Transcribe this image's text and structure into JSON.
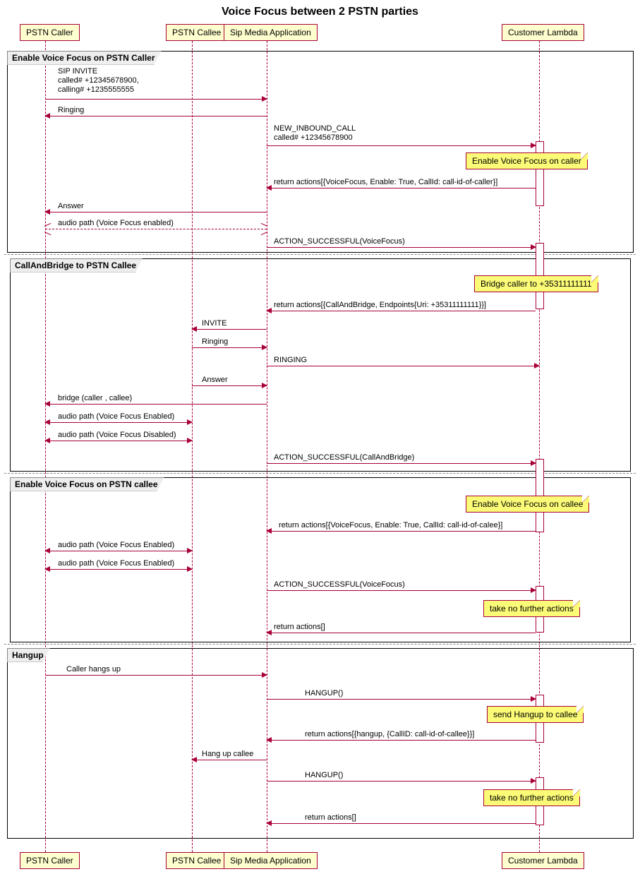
{
  "title": "Voice Focus between 2 PSTN parties",
  "participants": {
    "caller": "PSTN Caller",
    "callee": "PSTN Callee",
    "sma": "Sip Media Application",
    "lambda": "Customer Lambda"
  },
  "groups": {
    "g1": "Enable Voice Focus on PSTN Caller",
    "g2": "CallAndBridge to PSTN Callee",
    "g3": "Enable Voice Focus on PSTN callee",
    "g4": "Hangup"
  },
  "notes": {
    "n1": "Enable Voice Focus on caller",
    "n2": "Bridge caller to +35311111111",
    "n3": "Enable Voice Focus on callee",
    "n4": "take no further actions",
    "n5": "send Hangup to callee",
    "n6": "take no further actions"
  },
  "messages": {
    "m1": "SIP INVITE\ncalled# +12345678900,\ncalling# +1235555555",
    "m2": "Ringing",
    "m3": "NEW_INBOUND_CALL\ncalled# +12345678900",
    "m4": "return actions[{VoiceFocus, Enable: True, CallId: call-id-of-caller}]",
    "m5": "Answer",
    "m6": "audio path (Voice Focus enabled)",
    "m7": "ACTION_SUCCESSFUL(VoiceFocus)",
    "m8": "return actions[{CallAndBridge, Endpoints{Uri: +35311111111}}]",
    "m9": "INVITE",
    "m10": "Ringing",
    "m11": "RINGING",
    "m12": "Answer",
    "m13": "bridge (caller , callee)",
    "m14": "audio path (Voice Focus Enabled)",
    "m15": "audio path (Voice Focus Disabled)",
    "m16": "ACTION_SUCCESSFUL(CallAndBridge)",
    "m17": "return actions[{VoiceFocus, Enable: True, CallId: call-id-of-calee}]",
    "m18": "audio path (Voice Focus Enabled)",
    "m19": "audio path (Voice Focus Enabled)",
    "m20": "ACTION_SUCCESSFUL(VoiceFocus)",
    "m21": "return actions[]",
    "m22": "Caller hangs up",
    "m23": "HANGUP()",
    "m24": "return actions[{hangup, {CallID: call-id-of-callee}}]",
    "m25": "Hang up callee",
    "m26": "HANGUP()",
    "m27": "return actions[]"
  }
}
